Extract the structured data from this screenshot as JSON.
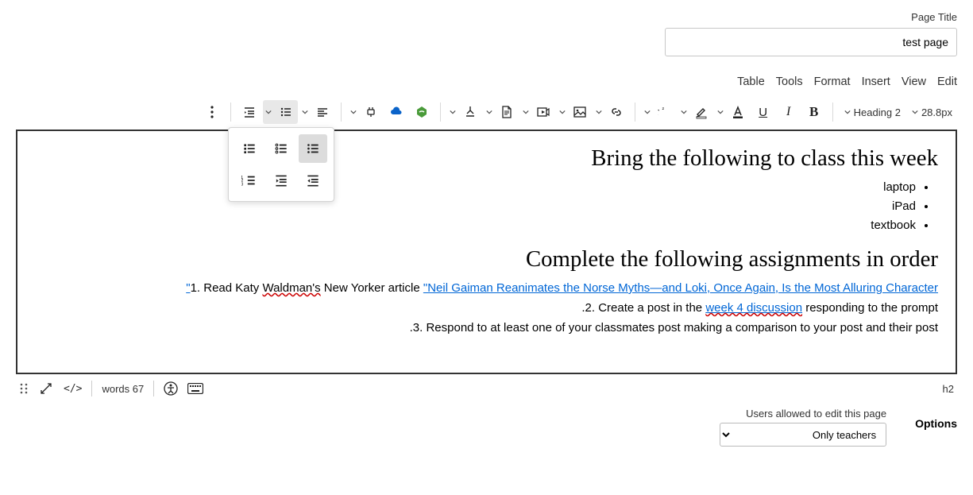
{
  "page_title_label": "Page Title",
  "page_title_value": "test page",
  "menubar": [
    "Edit",
    "View",
    "Insert",
    "Format",
    "Tools",
    "Table"
  ],
  "toolbar": {
    "font_size": "28.8px",
    "block_format": "Heading 2"
  },
  "dropdown_open": true,
  "content": {
    "h1": "Bring the following to class this week",
    "ul": [
      "laptop",
      "iPad",
      "textbook"
    ],
    "h2": "Complete the following assignments in order",
    "ol": [
      {
        "pre": "Read Katy ",
        "sq": "Waldman's",
        "mid": " New Yorker article ",
        "link": "\"Neil Gaiman Reanimates the Norse Myths—and Loki, Once Again, Is the Most Alluring Character\""
      },
      {
        "pre": "Create a post in the ",
        "link": "week 4 discussion",
        "post": " responding to the prompt."
      },
      {
        "full": "Respond to at least one of your classmates post making a comparison to your post and their post."
      }
    ]
  },
  "statusbar": {
    "path": "h2",
    "words": "67 words",
    "code": "</>"
  },
  "options": {
    "heading": "Options",
    "users_label": "Users allowed to edit this page",
    "users_value": "Only teachers"
  }
}
